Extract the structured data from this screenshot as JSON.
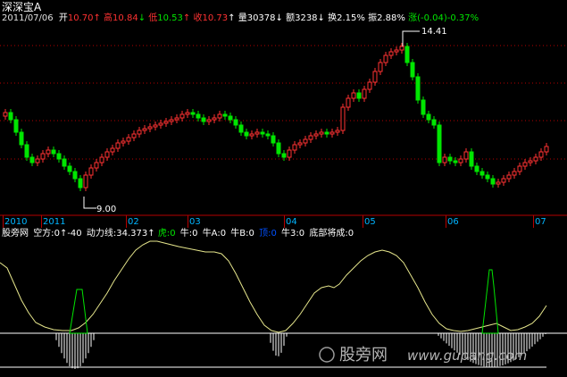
{
  "header": {
    "stock_name": "深深宝A",
    "date": "2011/07/06",
    "open_label": "开",
    "open_value": "10.70",
    "high_label": "高",
    "high_value": "10.84",
    "low_label": "低",
    "low_value": "10.53",
    "close_label": "收",
    "close_value": "10.73",
    "volume_label": "量",
    "volume_value": "30378",
    "amount_label": "额",
    "amount_value": "3238",
    "turnover_label": "换",
    "turnover_value": "2.15%",
    "amplitude_label": "振",
    "amplitude_value": "2.88%",
    "change_label": "涨",
    "change_value": "(-0.04)-0.37%"
  },
  "annotations": {
    "high_price": "14.41",
    "low_price": "9.00"
  },
  "time_axis": [
    "2010",
    "2011",
    "02",
    "03",
    "04",
    "05",
    "06",
    "07"
  ],
  "indicator": {
    "source": "股旁网",
    "empty_label": "空方:",
    "empty_value": "0",
    "empty_value2": "-40",
    "power_label": "动力线:",
    "power_value": "34.373",
    "tiger_label": "虎:",
    "tiger_value": "0",
    "bull_label": "牛:",
    "bull_value": "0",
    "bullA_label": "牛A:",
    "bullA_value": "0",
    "bullB_label": "牛B:",
    "bullB_value": "0",
    "ding_label": "顶:",
    "ding_value": "0",
    "bull3_label": "牛3:",
    "bull3_value": "0",
    "bottom_label": "底部将成:",
    "bottom_value": "0"
  },
  "watermark": {
    "text": "股旁网",
    "url": "www.gupang.com"
  },
  "colors": {
    "background": "#000000",
    "up": "#ff3232",
    "down": "#00e600",
    "grid": "#b40000",
    "power_line": "#e6e68c",
    "signal": "#00e600",
    "axis_text": "#00b4ff",
    "label_blue": "#0050ff"
  },
  "chart_data": {
    "type": "candlestick",
    "x_range": [
      "2010-12",
      "2011-07-06"
    ],
    "y_annotated": {
      "high": 14.41,
      "low": 9.0
    },
    "months": [
      "2010",
      "2011",
      "02",
      "03",
      "04",
      "05",
      "06",
      "07"
    ]
  }
}
